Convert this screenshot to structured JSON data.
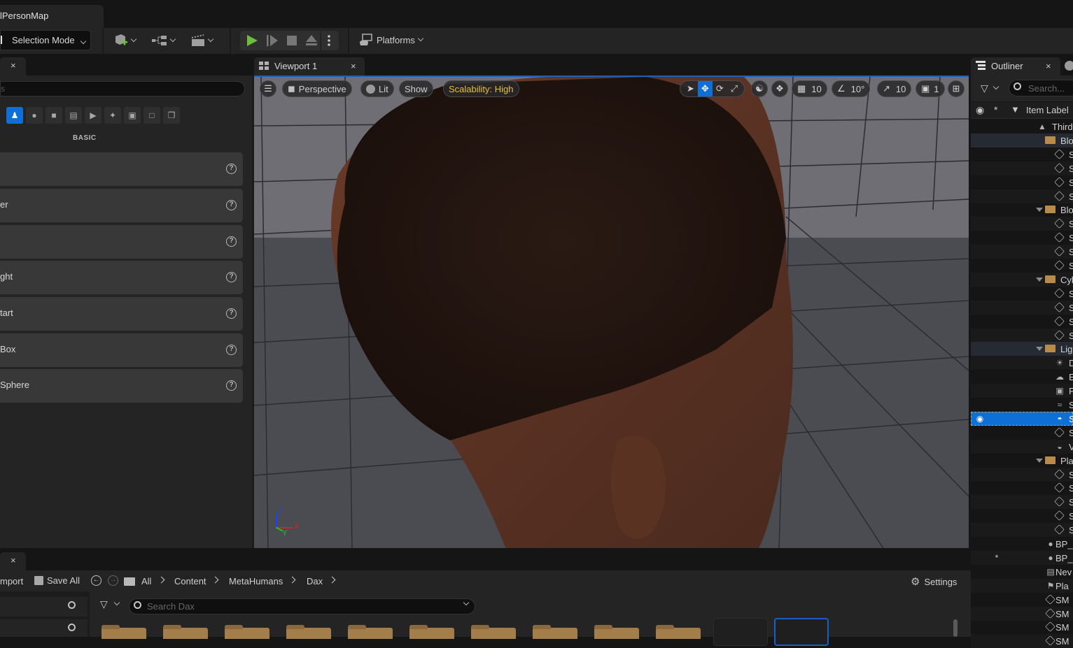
{
  "title_bar": {
    "map_tab": "lPersonMap"
  },
  "toolbar": {
    "selection_mode": "Selection Mode",
    "icons": [
      "add-actor-icon",
      "blueprint-icon",
      "cinematics-icon"
    ],
    "play_controls": [
      "play-icon",
      "step-icon",
      "stop-icon",
      "eject-icon",
      "more-icon"
    ],
    "platforms": "Platforms"
  },
  "place_actors": {
    "tab_close": "×",
    "search_placeholder": "s",
    "category_icons": [
      "basic-icon",
      "lights-icon",
      "shapes-icon",
      "cinematic-icon",
      "visual-effects-icon",
      "volumes-icon",
      "geometry-icon",
      "all-classes-icon",
      "recent-icon",
      "more-icon"
    ],
    "category_label": "BASIC",
    "items": [
      {
        "label": ""
      },
      {
        "label": "er"
      },
      {
        "label": ""
      },
      {
        "label": "ght"
      },
      {
        "label": "tart"
      },
      {
        "label": "Box"
      },
      {
        "label": "Sphere"
      }
    ],
    "help_glyph": "?"
  },
  "viewport": {
    "tab_label": "Viewport 1",
    "tab_close": "×",
    "perspective": "Perspective",
    "lit": "Lit",
    "show": "Show",
    "scalability": "Scalability: High",
    "grid_snap": "10",
    "rotation_snap": "10°",
    "scale_snap": "10",
    "camera_speed": "1",
    "axis": {
      "z": "Z",
      "x": "X",
      "y": "Y"
    }
  },
  "outliner": {
    "tab_label": "Outliner",
    "tab_close": "×",
    "search_placeholder": "Search...",
    "column_label": "Item Label",
    "rows": [
      {
        "label": "Third",
        "type": "world",
        "indent": 0
      },
      {
        "label": "Blo",
        "type": "folder",
        "indent": 1,
        "expanded": false
      },
      {
        "label": "S",
        "type": "mesh",
        "indent": 2
      },
      {
        "label": "S",
        "type": "mesh",
        "indent": 2
      },
      {
        "label": "S",
        "type": "mesh",
        "indent": 2
      },
      {
        "label": "S",
        "type": "mesh",
        "indent": 2
      },
      {
        "label": "Blo",
        "type": "folder",
        "indent": 1,
        "expanded": true
      },
      {
        "label": "S",
        "type": "mesh",
        "indent": 2
      },
      {
        "label": "S",
        "type": "mesh",
        "indent": 2
      },
      {
        "label": "S",
        "type": "mesh",
        "indent": 2
      },
      {
        "label": "S",
        "type": "mesh",
        "indent": 2
      },
      {
        "label": "Cyl",
        "type": "folder",
        "indent": 1,
        "expanded": true
      },
      {
        "label": "S",
        "type": "mesh",
        "indent": 2
      },
      {
        "label": "S",
        "type": "mesh",
        "indent": 2
      },
      {
        "label": "S",
        "type": "mesh",
        "indent": 2
      },
      {
        "label": "S",
        "type": "mesh",
        "indent": 2
      },
      {
        "label": "Lig",
        "type": "folder",
        "indent": 1,
        "expanded": true
      },
      {
        "label": "D",
        "type": "directional-light",
        "indent": 2
      },
      {
        "label": "E",
        "type": "exponential-fog",
        "indent": 2
      },
      {
        "label": "F",
        "type": "reflection-capture",
        "indent": 2
      },
      {
        "label": "S",
        "type": "sky-atmosphere",
        "indent": 2
      },
      {
        "label": "S",
        "type": "sky-light",
        "indent": 2,
        "selected": true
      },
      {
        "label": "S",
        "type": "mesh",
        "indent": 2
      },
      {
        "label": "V",
        "type": "volumetric-cloud",
        "indent": 2
      },
      {
        "label": "Pla",
        "type": "folder",
        "indent": 1,
        "expanded": true
      },
      {
        "label": "S",
        "type": "mesh",
        "indent": 2
      },
      {
        "label": "S",
        "type": "mesh",
        "indent": 2
      },
      {
        "label": "S",
        "type": "mesh",
        "indent": 2
      },
      {
        "label": "S",
        "type": "mesh",
        "indent": 2
      },
      {
        "label": "S",
        "type": "mesh",
        "indent": 2
      },
      {
        "label": "BP_",
        "type": "blueprint",
        "indent": 0
      },
      {
        "label": "BP_",
        "type": "blueprint",
        "indent": 0,
        "pinned_star": true
      },
      {
        "label": "Nev",
        "type": "level-sequence",
        "indent": 0
      },
      {
        "label": "Pla",
        "type": "player-start",
        "indent": 0
      },
      {
        "label": "SM",
        "type": "mesh",
        "indent": 0
      },
      {
        "label": "SM",
        "type": "mesh",
        "indent": 0
      },
      {
        "label": "SM",
        "type": "mesh",
        "indent": 0
      },
      {
        "label": "SM",
        "type": "mesh",
        "indent": 0
      }
    ]
  },
  "content_browser": {
    "tab_close": "×",
    "import_label": "mport",
    "save_all": "Save All",
    "breadcrumb": [
      "All",
      "Content",
      "MetaHumans",
      "Dax"
    ],
    "settings": "Settings",
    "search_placeholder": "Search Dax",
    "folder_count": 10,
    "thumbnail_count": 2
  }
}
